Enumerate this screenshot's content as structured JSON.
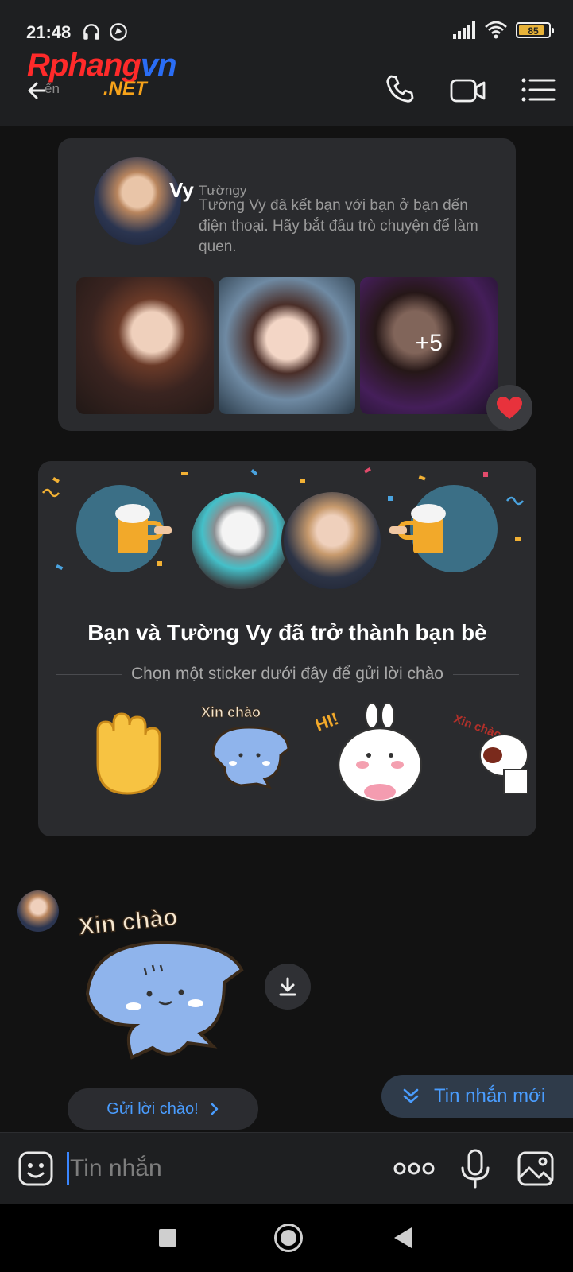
{
  "status_bar": {
    "time": "21:48",
    "battery_level": "85",
    "icons": [
      "headphones-icon",
      "location-icon",
      "signal-icon",
      "wifi-icon",
      "battery-icon"
    ]
  },
  "watermark": {
    "part1": "Rphang",
    "part2": "vn",
    "sub": ".NET"
  },
  "header": {
    "back_hint": "ến",
    "actions": [
      "call-icon",
      "video-call-icon",
      "menu-icon"
    ]
  },
  "profile_card": {
    "name": "Vy",
    "intro_blur": "Tườngy",
    "intro_text": "Tường Vy đã kết bạn với bạn ở bạn đến điện thoại. Hãy bắt đầu trò chuyện để làm quen.",
    "extra_photos": "+5"
  },
  "friend_card": {
    "title": "Bạn và Tường Vy đã trở thành bạn bè",
    "subtitle": "Chọn một sticker dưới đây để gửi lời chào",
    "stickers": [
      "waving-hand-sticker",
      "xin-chao-cat-sticker",
      "hi-bunny-sticker",
      "xin-chao-dog-sticker"
    ],
    "sticker_text_cat": "Xin chào",
    "sticker_text_bunny": "HI!",
    "sticker_text_dog": "Xin chào"
  },
  "message": {
    "sticker_text": "Xin chào"
  },
  "greet_button": {
    "label": "Gửi lời chào!"
  },
  "new_messages": {
    "label": "Tin nhắn mới"
  },
  "input": {
    "placeholder": "Tin nhắn"
  },
  "colors": {
    "accent": "#4a9dff",
    "card": "#2a2b2e",
    "background": "#121212",
    "battery": "#e8b339"
  }
}
